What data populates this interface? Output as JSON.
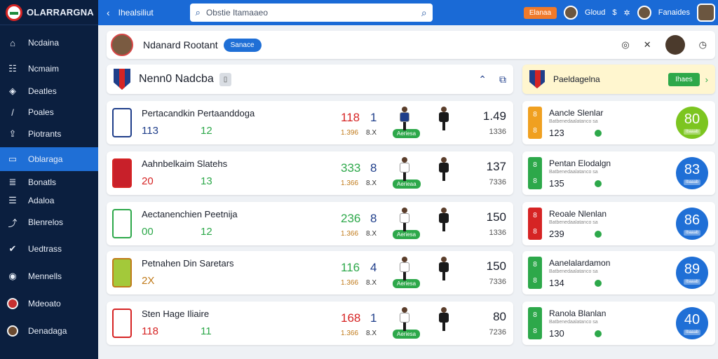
{
  "app": {
    "title": "OLARRARGNA"
  },
  "sidebar": {
    "items": [
      {
        "label": "Ncdaina",
        "icon": "home-icon",
        "glyph": "⌂"
      },
      {
        "label": "Ncmaim",
        "icon": "users-icon",
        "glyph": "☷"
      },
      {
        "label": "Deatles",
        "icon": "shield-icon",
        "glyph": "◈"
      },
      {
        "label": "Poales",
        "icon": "slash-icon",
        "glyph": "/"
      },
      {
        "label": "Piotrants",
        "icon": "upload-icon",
        "glyph": "⇪"
      },
      {
        "label": "Oblaraga",
        "icon": "panel-icon",
        "glyph": "▭"
      },
      {
        "label": "Bonatls",
        "icon": "list-icon",
        "glyph": "≣"
      },
      {
        "label": "Adaloa",
        "icon": "table-icon",
        "glyph": "☰"
      },
      {
        "label": "Blenrelos",
        "icon": "trend-icon",
        "glyph": "⤴"
      },
      {
        "label": "Uedtrass",
        "icon": "check-icon",
        "glyph": "✔"
      },
      {
        "label": "Mennells",
        "icon": "badge-icon",
        "glyph": "◉"
      },
      {
        "label": "Mdeoato",
        "icon": "ball-icon"
      },
      {
        "label": "Denadaga",
        "icon": "ball-icon"
      }
    ],
    "active_index": 5
  },
  "topbar": {
    "breadcrumb": "Ihealsiliut",
    "search_placeholder": "Obstie Itamaaeo",
    "orange_label": "Elanaa",
    "user1": "Gloud",
    "user2": "Fanaides"
  },
  "profile": {
    "name": "Ndanard Rootant",
    "badge": "Sanace"
  },
  "team_header": {
    "title": "Nenn0 Nadcba",
    "tag": "▯"
  },
  "comp_header": {
    "title": "Paeldagelna",
    "button": "Ihaes"
  },
  "matches": [
    {
      "title": "Pertacandkin Pertaanddoga",
      "a": "113",
      "b": "12",
      "s1": "118",
      "s2": "1",
      "m1": "1.396",
      "m2": "8.X",
      "tag": "Aeriesa",
      "big": "1.49",
      "pct": "1336",
      "logo": "#ffffff",
      "s1_color": "#d62424",
      "a_color": "#1f3e8a",
      "ptop": "#1f3e8a"
    },
    {
      "title": "Aahnbelkaim Slatehs",
      "a": "20",
      "b": "13",
      "s1": "333",
      "s2": "8",
      "m1": "1.366",
      "m2": "8.X",
      "tag": "Aerieaa",
      "big": "137",
      "pct": "7336",
      "logo": "#c8202a",
      "s1_color": "#2da84a",
      "a_color": "#d62424",
      "ptop": "#ffffff"
    },
    {
      "title": "Aectanenchien Peetnija",
      "a": "00",
      "b": "12",
      "s1": "236",
      "s2": "8",
      "m1": "1.366",
      "m2": "8.X",
      "tag": "Aeriesa",
      "big": "150",
      "pct": "1336",
      "logo": "#ffffff",
      "s1_color": "#2da84a",
      "a_color": "#2da84a",
      "ptop": "#ffffff"
    },
    {
      "title": "Petnahen Din Saretars",
      "a": "2X",
      "b": "",
      "s1": "116",
      "s2": "4",
      "m1": "1.366",
      "m2": "8.X",
      "tag": "Aeriesa",
      "big": "150",
      "pct": "7336",
      "logo": "#a3c93a",
      "s1_color": "#2da84a",
      "a_color": "#c07a1a",
      "ptop": "#ffffff"
    },
    {
      "title": "Sten Hage Iliaire",
      "a": "118",
      "b": "11",
      "s1": "168",
      "s2": "1",
      "m1": "1.366",
      "m2": "8.X",
      "tag": "Aeriesa",
      "big": "80",
      "pct": "7236",
      "logo": "#ffffff",
      "s1_color": "#d62424",
      "a_color": "#d62424",
      "ptop": "#ffffff"
    }
  ],
  "competitions": [
    {
      "title": "Aancle Slenlar",
      "sub": "Batbenedaalatanco sa",
      "val": "123",
      "bar": "#f0a020",
      "score": "80",
      "color": "#7cc520",
      "small": "Ibaaab"
    },
    {
      "title": "Pentan Elodalgn",
      "sub": "Batbenedaalatanco sa",
      "val": "135",
      "bar": "#2da84a",
      "score": "83",
      "color": "#1f6fd6",
      "small": "Ibaaab"
    },
    {
      "title": "Reoale Nlenlan",
      "sub": "Batbenedaalatanco sa",
      "val": "239",
      "bar": "#d62424",
      "score": "86",
      "color": "#1f6fd6",
      "small": "Ibaaab"
    },
    {
      "title": "Aanelalardamon",
      "sub": "Batbenedaalatanco sa",
      "val": "134",
      "bar": "#2da84a",
      "score": "89",
      "color": "#1f6fd6",
      "small": "Ibaaab"
    },
    {
      "title": "Ranola Blanlan",
      "sub": "Batbenedaalatanco sa",
      "val": "130",
      "bar": "#2da84a",
      "score": "40",
      "color": "#1f6fd6",
      "small": "Ibaaab"
    }
  ]
}
